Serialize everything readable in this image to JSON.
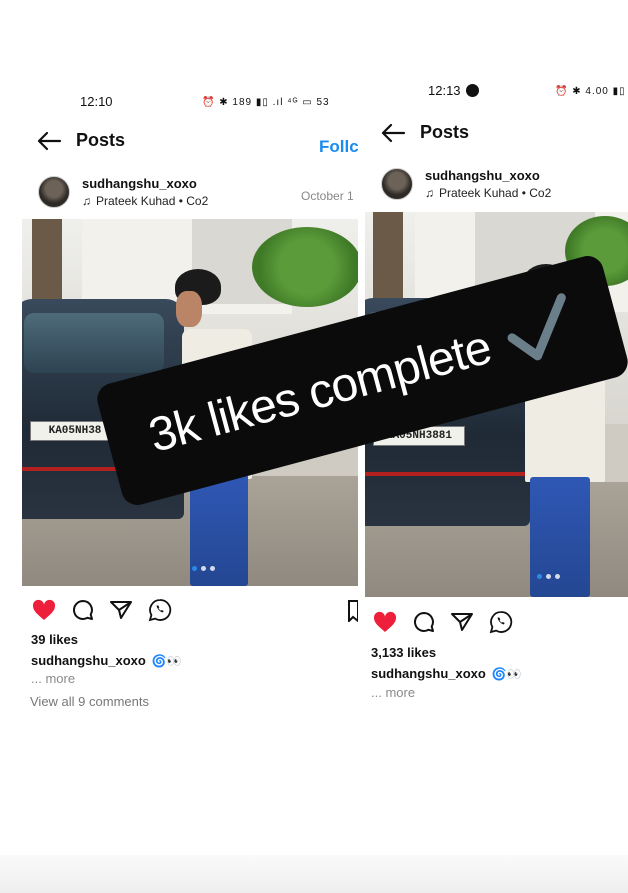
{
  "left": {
    "status": {
      "time": "12:10",
      "icons": "⏰ ✱ 189 ▮▯ .ıl ⁴ᴳ ▭ 53"
    },
    "nav": {
      "title": "Posts",
      "follow": "Follc"
    },
    "post": {
      "username": "sudhangshu_xoxo",
      "song": "Prateek Kuhad • Co2",
      "date": "October 1",
      "plate": "KA05NH38",
      "likes": "39 likes",
      "caption_user": "sudhangshu_xoxo",
      "caption_emoji": "🌀👀",
      "more": "... more",
      "comments": "View all 9 comments"
    }
  },
  "right": {
    "status": {
      "time": "12:13",
      "icons": "⏰ ✱ 4.00 ▮▯"
    },
    "nav": {
      "title": "Posts"
    },
    "post": {
      "username": "sudhangshu_xoxo",
      "song": "Prateek Kuhad • Co2",
      "plate": "KA05NH3881",
      "likes": "3,133 likes",
      "caption_user": "sudhangshu_xoxo",
      "caption_emoji": "🌀👀",
      "more": "... more"
    }
  },
  "banner": {
    "text": "3k likes complete"
  },
  "colors": {
    "like_red": "#ed1f3a",
    "follow_blue": "#1a8cf0",
    "banner_bg": "#0b0b0b",
    "check_gray": "#6b7f8a"
  }
}
